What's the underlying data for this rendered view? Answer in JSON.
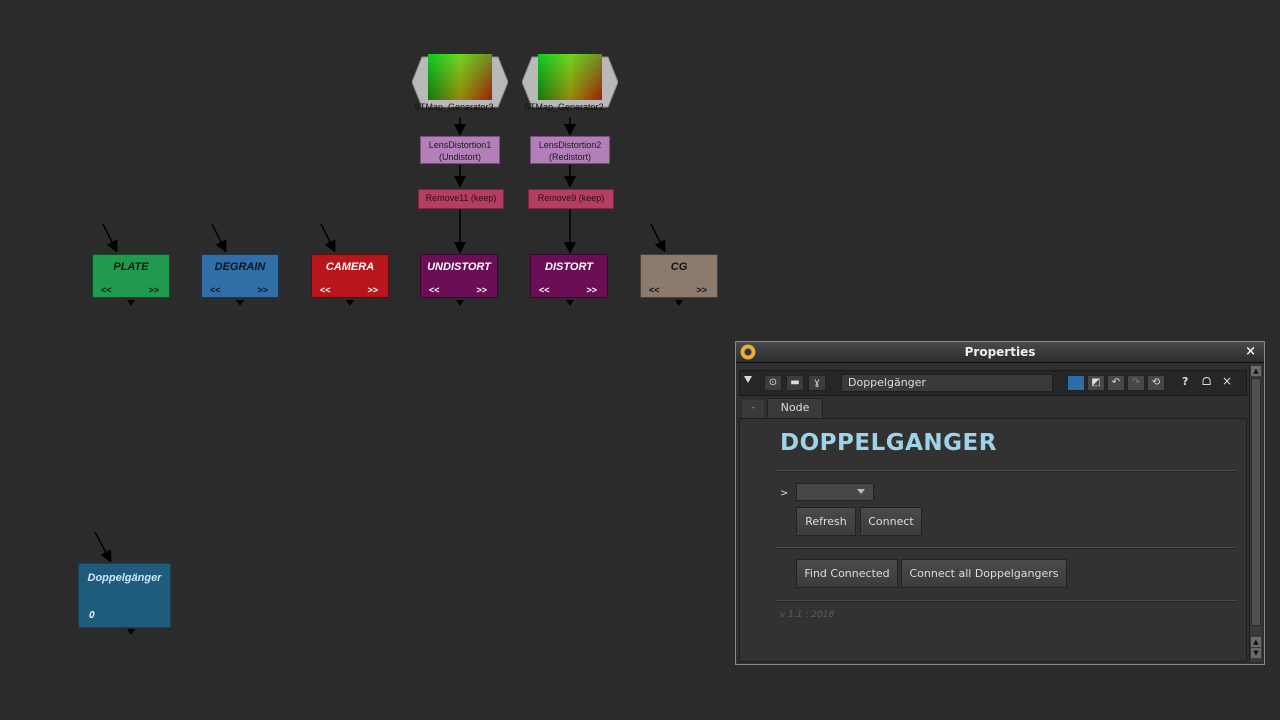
{
  "graph": {
    "stmap_nodes": [
      {
        "label": "STMap_Generator3"
      },
      {
        "label": "STMap_Generator2"
      }
    ],
    "lens_nodes": [
      {
        "line1": "LensDistortion1",
        "line2": "(Undistort)"
      },
      {
        "line1": "LensDistortion2",
        "line2": "(Redistort)"
      }
    ],
    "remove_nodes": [
      {
        "label": "Remove11 (keep)"
      },
      {
        "label": "Remove9 (keep)"
      }
    ],
    "dot_nodes": [
      {
        "title": "PLATE",
        "left": "<<",
        "right": ">>",
        "color": "#1f9a4e",
        "text_color": "#0c1a10"
      },
      {
        "title": "DEGRAIN",
        "left": "<<",
        "right": ">>",
        "color": "#2f6ea6",
        "text_color": "#0b1624"
      },
      {
        "title": "CAMERA",
        "left": "<<",
        "right": ">>",
        "color": "#b8151c",
        "text_color": "#ffffff"
      },
      {
        "title": "UNDISTORT",
        "left": "<<",
        "right": ">>",
        "color": "#6c0d57",
        "text_color": "#ffffff"
      },
      {
        "title": "DISTORT",
        "left": "<<",
        "right": ">>",
        "color": "#6c0d57",
        "text_color": "#ffffff"
      },
      {
        "title": "CG",
        "left": "<<",
        "right": ">>",
        "color": "#8c7a6d",
        "text_color": "#111111"
      }
    ],
    "doppelganger_node": {
      "title": "Doppelgänger",
      "count": "0"
    }
  },
  "properties": {
    "title": "Properties",
    "close": "×",
    "node_name": "Doppelgänger",
    "tab": "Node",
    "tab_collapse": "-",
    "heading": "DOPPELGANGER",
    "prompt": ">",
    "buttons": {
      "refresh": "Refresh",
      "connect": "Connect",
      "find_connected": "Find Connected",
      "connect_all": "Connect all Doppelgangers"
    },
    "version": "v 1.1 : 2018",
    "toolbar_right": {
      "help": "?",
      "float": "ᗝ",
      "close": "×"
    }
  }
}
